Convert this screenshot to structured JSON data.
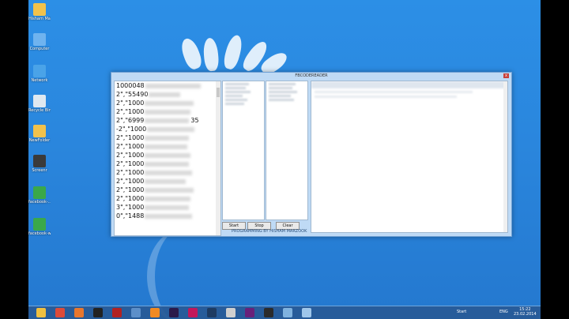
{
  "window": {
    "title": "FBCODEREADER",
    "close": "x",
    "left_rows": [
      {
        "prefix": "1000048",
        "suffix": ""
      },
      {
        "prefix": "2\",\"55490",
        "suffix": ""
      },
      {
        "prefix": "2\",\"1000",
        "suffix": ""
      },
      {
        "prefix": "2\",\"1000",
        "suffix": ""
      },
      {
        "prefix": "2\",\"6999",
        "suffix": "35"
      },
      {
        "prefix": "-2\",\"1000",
        "suffix": ""
      },
      {
        "prefix": "2\",\"1000",
        "suffix": ""
      },
      {
        "prefix": "2\",\"1000",
        "suffix": ""
      },
      {
        "prefix": "2\",\"1000",
        "suffix": ""
      },
      {
        "prefix": "2\",\"1000",
        "suffix": ""
      },
      {
        "prefix": "2\",\"1000",
        "suffix": ""
      },
      {
        "prefix": "2\",\"1000",
        "suffix": ""
      },
      {
        "prefix": "2\",\"1000",
        "suffix": ""
      },
      {
        "prefix": "2\",\"1000",
        "suffix": ""
      },
      {
        "prefix": "3\",\"1000",
        "suffix": ""
      },
      {
        "prefix": "0\",\"1488",
        "suffix": ""
      }
    ],
    "buttons": {
      "start": "Start",
      "stop": "Stop",
      "clear": "Clear"
    },
    "credit": "PROGRAMMING BY HISHAM MARZOOK"
  },
  "desktop_icons": [
    {
      "label": "Hisham Marzook",
      "icon": "folder-icon",
      "color": "#f2c24b"
    },
    {
      "label": "Computer",
      "icon": "computer-icon",
      "color": "#6fb3ef"
    },
    {
      "label": "Network",
      "icon": "network-icon",
      "color": "#4aa3e8"
    },
    {
      "label": "Recycle Bin",
      "icon": "recycle-bin-icon",
      "color": "#dfe8f0"
    },
    {
      "label": "NewFolder",
      "icon": "folder-icon",
      "color": "#f2c24b"
    },
    {
      "label": "Screenr",
      "icon": "file-icon",
      "color": "#3a3a3a"
    },
    {
      "label": "facebook-...",
      "icon": "mp4-icon",
      "color": "#3aa84a"
    },
    {
      "label": "facebook-whatsapp",
      "icon": "mp4-icon",
      "color": "#3aa84a"
    }
  ],
  "taskbar": {
    "start_label": "Start",
    "lang": "ENG",
    "time": "15:22",
    "date": "23.02.2014",
    "apps": [
      {
        "icon": "file-explorer-icon",
        "color": "#f0c040"
      },
      {
        "icon": "chrome-icon",
        "color": "#dd4b39"
      },
      {
        "icon": "firefox-icon",
        "color": "#e8772e"
      },
      {
        "icon": "terminal-icon",
        "color": "#222222"
      },
      {
        "icon": "filezilla-icon",
        "color": "#b22222"
      },
      {
        "icon": "window-icon",
        "color": "#5c8fc9"
      },
      {
        "icon": "media-player-icon",
        "color": "#f08a24"
      },
      {
        "icon": "after-effects-icon",
        "color": "#2a1a4a"
      },
      {
        "icon": "screen-recorder-icon",
        "color": "#c2185b"
      },
      {
        "icon": "photoshop-icon",
        "color": "#1d3b62"
      },
      {
        "icon": "feather-icon",
        "color": "#cfcfcf"
      },
      {
        "icon": "visual-studio-icon",
        "color": "#68217a"
      },
      {
        "icon": "obs-icon",
        "color": "#2b2b2b"
      },
      {
        "icon": "app-icon",
        "color": "#7fb2df"
      },
      {
        "icon": "fbcodereader-icon",
        "color": "#9ec6ea"
      }
    ]
  }
}
